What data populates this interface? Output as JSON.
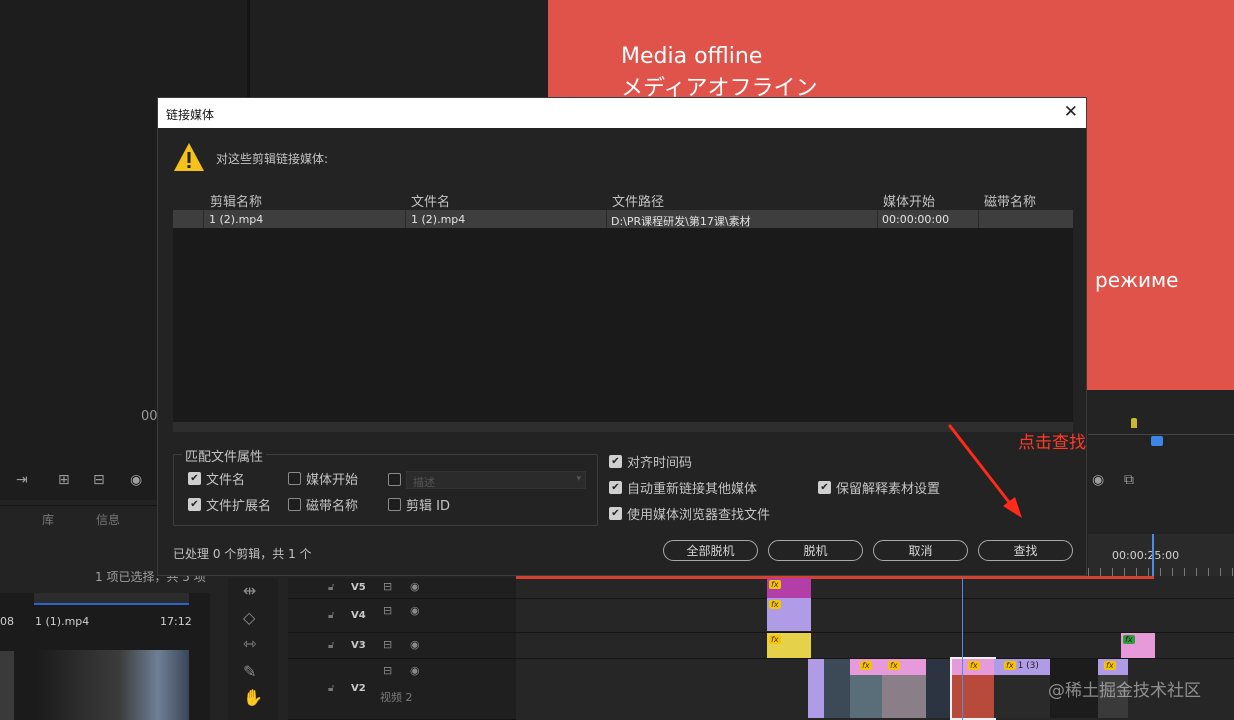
{
  "background": {
    "offline_en": "Media offline",
    "offline_jp": "メディアオフライン",
    "offline_ru": "режиме",
    "timecode_left": "00",
    "panel_tabs": [
      "库",
      "信息"
    ],
    "items_selected": "1 项已选择，共 5 项",
    "thumb_timecode": "08",
    "thumb_clip_name": "1 (1).mp4",
    "thumb_clip_duration": "17:12",
    "timeline_timecode": "00:00:25:00",
    "tracks": [
      {
        "name": "V5",
        "label": ""
      },
      {
        "name": "V4",
        "label": ""
      },
      {
        "name": "V3",
        "label": ""
      },
      {
        "name": "V2",
        "label": "视频 2"
      }
    ],
    "timeline_clip_label": "1 (3)",
    "fx_label": "fx"
  },
  "annotation": {
    "text": "点击查找",
    "color": "#ff3a2a"
  },
  "watermark": "@稀土掘金技术社区",
  "dialog": {
    "title": "链接媒体",
    "close_glyph": "✕",
    "message": "对这些剪辑链接媒体:",
    "columns": [
      "剪辑名称",
      "文件名",
      "文件路径",
      "媒体开始",
      "磁带名称"
    ],
    "rows": [
      {
        "clip_name": "1 (2).mp4",
        "file_name": "1 (2).mp4",
        "file_path": "D:\\PR课程研发\\第17课\\素材",
        "media_start": "00:00:00:00",
        "tape_name": ""
      }
    ],
    "match_group": {
      "label": "匹配文件属性",
      "file_name": {
        "label": "文件名",
        "checked": true
      },
      "file_extension": {
        "label": "文件扩展名",
        "checked": true
      },
      "media_start": {
        "label": "媒体开始",
        "checked": false
      },
      "tape_name": {
        "label": "磁带名称",
        "checked": false
      },
      "description": {
        "label": "描述",
        "checked": false
      },
      "clip_id": {
        "label": "剪辑 ID",
        "checked": false
      }
    },
    "options": {
      "align_timecode": {
        "label": "对齐时间码",
        "checked": true
      },
      "relink_others": {
        "label": "自动重新链接其他媒体",
        "checked": true
      },
      "use_media_browser": {
        "label": "使用媒体浏览器查找文件",
        "checked": true
      },
      "preserve_interpret": {
        "label": "保留解释素材设置",
        "checked": true
      }
    },
    "status": "已处理 0 个剪辑，共 1 个",
    "buttons": {
      "offline_all": "全部脱机",
      "offline": "脱机",
      "cancel": "取消",
      "locate": "查找"
    }
  },
  "colors": {
    "offline_frame": "#e0534a",
    "accent_blue": "#3d86e6",
    "clip_violet": "#b09be6",
    "clip_magenta": "#b43ea8",
    "clip_yellow": "#e6d24a",
    "clip_pink": "#e79ad9"
  }
}
